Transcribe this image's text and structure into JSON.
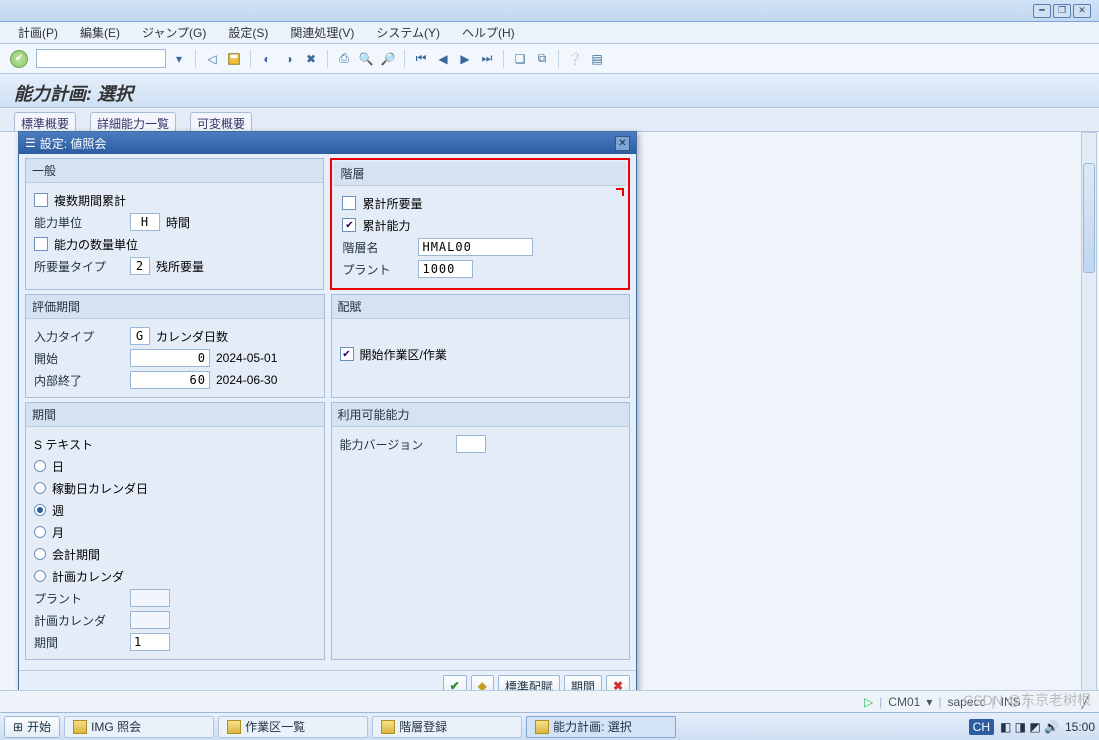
{
  "menu": {
    "plan": "計画(P)",
    "edit": "編集(E)",
    "jump": "ジャンプ(G)",
    "settings": "設定(S)",
    "related": "関連処理(V)",
    "system": "システム(Y)",
    "help": "ヘルプ(H)"
  },
  "page_title": "能力計画: 選択",
  "subtabs": {
    "std": "標準概要",
    "detail": "詳細能力一覧",
    "var": "可変概要"
  },
  "dialog": {
    "title": "設定: 値照会",
    "general": {
      "head": "一般",
      "multi_period": "複数期間累計",
      "cap_unit_lbl": "能力単位",
      "cap_unit_val": "H",
      "cap_unit_txt": "時間",
      "cap_qty_unit": "能力の数量単位",
      "req_type_lbl": "所要量タイプ",
      "req_type_val": "2",
      "req_type_txt": "残所要量"
    },
    "hierarchy": {
      "head": "階層",
      "cum_req": "累計所要量",
      "cum_cap": "累計能力",
      "hier_name_lbl": "階層名",
      "hier_name_val": "HMAL00",
      "plant_lbl": "プラント",
      "plant_val": "1000"
    },
    "evalperiod": {
      "head": "評価期間",
      "input_type_lbl": "入力タイプ",
      "input_type_val": "G",
      "input_type_txt": "カレンダ日数",
      "start_lbl": "開始",
      "start_val": "0",
      "start_date": "2024-05-01",
      "end_lbl": "内部終了",
      "end_val": "60",
      "end_date": "2024-06-30"
    },
    "dist": {
      "head": "配賦",
      "wc_op": "開始作業区/作業"
    },
    "period": {
      "head": "期間",
      "s_text": "S テキスト",
      "day": "日",
      "wday": "稼動日カレンダ日",
      "week": "週",
      "month": "月",
      "fiscal": "会計期間",
      "plan_cal": "計画カレンダ",
      "plant_lbl": "プラント",
      "plan_cal_lbl": "計画カレンダ",
      "period_lbl": "期間",
      "period_val": "1"
    },
    "avail": {
      "head": "利用可能能力",
      "cap_ver_lbl": "能力バージョン"
    },
    "buttons": {
      "std_assign": "標準配賦",
      "period": "期間"
    }
  },
  "status": {
    "tcode": "CM01",
    "sys": "sapecc",
    "mode": "INS"
  },
  "taskbar": {
    "start": "开始",
    "t1": "IMG 照会",
    "t2": "作業区一覧",
    "t3": "階層登録",
    "t4": "能力計画: 選択",
    "time": "15:00",
    "lang": "CH"
  },
  "watermark": "CSDN @东京老树根"
}
